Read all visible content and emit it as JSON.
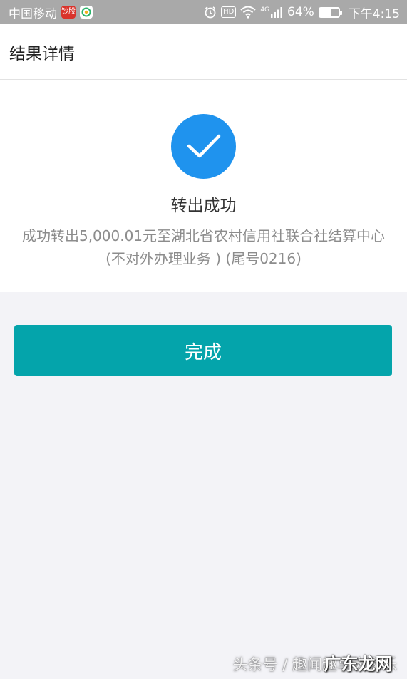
{
  "status_bar": {
    "carrier": "中国移动",
    "app_badge_text": "钞股",
    "hd": "HD",
    "network": "4G",
    "battery_percent": "64%",
    "battery_level": 0.64,
    "time": "下午4:15"
  },
  "header": {
    "title": "结果详情"
  },
  "result": {
    "icon": "check-icon",
    "title": "转出成功",
    "description": "成功转出5,000.01元至湖北省农村信用社联合社结算中心(不对外办理业务 ) (尾号0216)"
  },
  "actions": {
    "done_label": "完成"
  },
  "watermark": {
    "text": "头条号 / 趣闻趣享大家乐",
    "overlay": "广东龙网"
  },
  "colors": {
    "status_bar": "#a9a9a9",
    "accent": "#1f93ee",
    "button": "#04a4ab",
    "background": "#f3f3f7"
  }
}
